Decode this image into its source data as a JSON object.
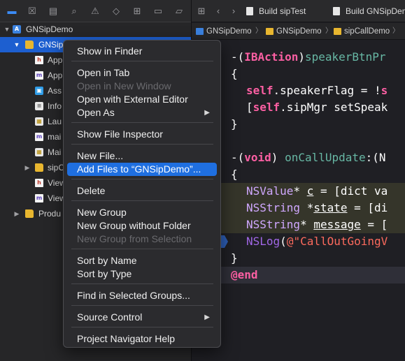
{
  "navigator": {
    "toolbar": [
      "folder-icon",
      "source-control-icon",
      "symbol-navigator-icon",
      "search-icon",
      "issue-icon",
      "test-icon",
      "debug-icon",
      "breakpoint-icon",
      "report-icon"
    ],
    "root_label": "GNSipDemo",
    "group_label": "GNSip",
    "rows": [
      "App",
      "App",
      "Ass",
      "Info",
      "Lau",
      "mai",
      "Mai",
      "sipC",
      "View",
      "View",
      "Produ"
    ]
  },
  "editor": {
    "tabs": [
      "Build sipTest",
      "Build GNSipDem"
    ],
    "breadcrumbs": [
      "GNSipDemo",
      "GNSipDemo",
      "sipCallDemo"
    ],
    "code": {
      "l1_a": "-(",
      "l1_b": "IBAction",
      "l1_c": ")",
      "l1_d": "speakerBtnPr",
      "l2": "{",
      "l3_a": "self",
      "l3_b": ".speakerFlag = !",
      "l3_c": "s",
      "l4_a": "[",
      "l4_b": "self",
      "l4_c": ".sipMgr setSpeak",
      "l5": "}",
      "l7_a": "-(",
      "l7_b": "void",
      "l7_c": ") ",
      "l7_d": "onCallUpdate",
      "l7_e": ":(N",
      "l8": "{",
      "l9_a": "NSValue",
      "l9_b": "* ",
      "l9_c": "c",
      "l9_d": " = [dict va",
      "l10_a": "NSString",
      "l10_b": " *",
      "l10_c": "state",
      "l10_d": " = [di",
      "l11_a": "NSString",
      "l11_b": "* ",
      "l11_c": "message",
      "l11_d": " = [",
      "l12_a": "NSLog",
      "l12_b": "(",
      "l12_c": "@\"CallOutGoingV",
      "l13": "}",
      "l14": "@end"
    }
  },
  "context_menu": {
    "show_in_finder": "Show in Finder",
    "open_in_tab": "Open in Tab",
    "open_in_new_window": "Open in New Window",
    "open_with_external_editor": "Open with External Editor",
    "open_as": "Open As",
    "show_file_inspector": "Show File Inspector",
    "new_file": "New File...",
    "add_files": "Add Files to “GNSipDemo”...",
    "delete": "Delete",
    "new_group": "New Group",
    "new_group_without_folder": "New Group without Folder",
    "new_group_from_selection": "New Group from Selection",
    "sort_by_name": "Sort by Name",
    "sort_by_type": "Sort by Type",
    "find_in_selected_groups": "Find in Selected Groups...",
    "source_control": "Source Control",
    "project_navigator_help": "Project Navigator Help"
  },
  "colors": {
    "selection": "#1d5fd0",
    "menu_highlight": "#1f6fe0",
    "keyword": "#fc5fa3",
    "string": "#fc6a5d"
  }
}
